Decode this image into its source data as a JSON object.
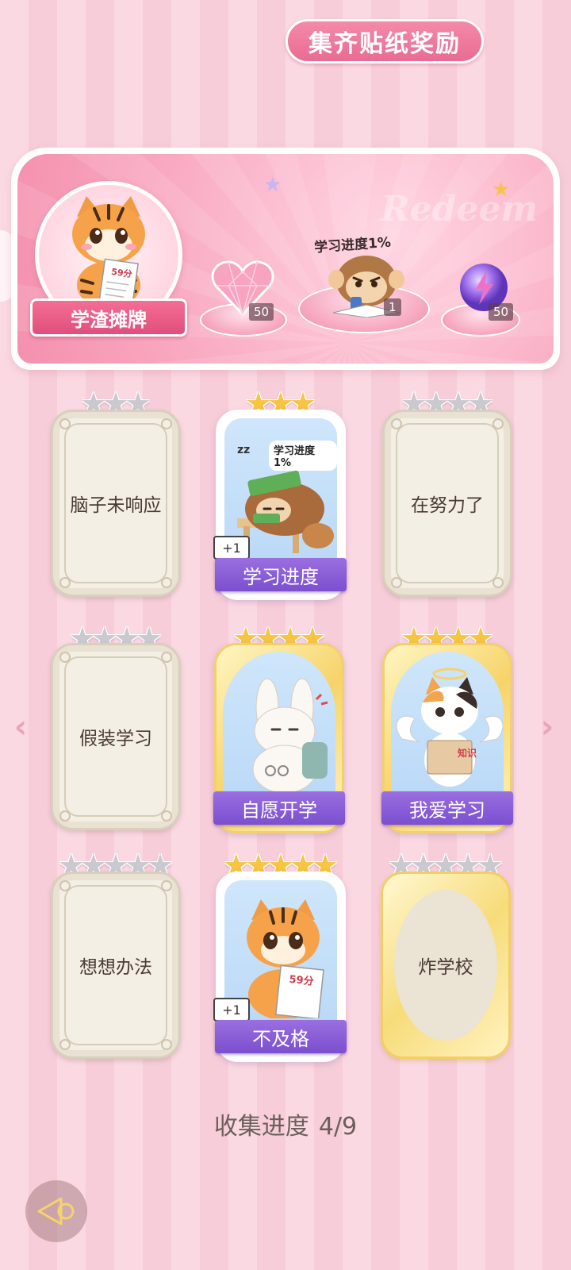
{
  "reward_panel": {
    "title": "集齐贴纸奖励",
    "watermark": "Redeem",
    "avatar_label": "学渣摊牌",
    "avatar_score": "59分",
    "progress_caption": "学习进度1%",
    "rewards": [
      {
        "icon": "heart-gem-icon",
        "count": "50"
      },
      {
        "icon": "monkey-sticker-icon",
        "count": "1"
      },
      {
        "icon": "lightning-orb-icon",
        "count": "50"
      }
    ]
  },
  "cards": [
    {
      "label": "脑子未响应",
      "stars": 3,
      "star_color": "silver",
      "state": "locked"
    },
    {
      "label": "学习进度",
      "stars": 3,
      "star_color": "gold",
      "state": "owned",
      "art_caption": "学习进度1%",
      "plus": "+1"
    },
    {
      "label": "在努力了",
      "stars": 4,
      "star_color": "silver",
      "state": "locked"
    },
    {
      "label": "假装学习",
      "stars": 4,
      "star_color": "silver",
      "state": "locked"
    },
    {
      "label": "自愿开学",
      "stars": 4,
      "star_color": "gold",
      "state": "owned"
    },
    {
      "label": "我爱学习",
      "stars": 4,
      "star_color": "gold",
      "state": "owned",
      "book_text": "知识"
    },
    {
      "label": "想想办法",
      "stars": 5,
      "star_color": "silver",
      "state": "locked"
    },
    {
      "label": "不及格",
      "stars": 5,
      "star_color": "gold",
      "state": "owned",
      "score": "59分",
      "plus": "+1"
    },
    {
      "label": "炸学校",
      "stars": 5,
      "star_color": "silver",
      "state": "gold-locked"
    }
  ],
  "progress": {
    "label": "收集进度",
    "value": "4/9"
  },
  "colors": {
    "accent_pink": "#e86c91",
    "ribbon_purple": "#8a5fd8",
    "gold_star": "#f7c543"
  }
}
